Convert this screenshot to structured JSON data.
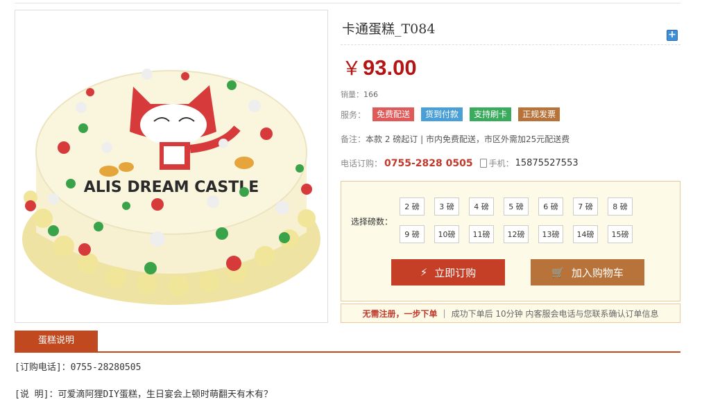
{
  "product": {
    "title": "卡通蛋糕_T084",
    "image_alt": "ALIS DREAM CASTLE",
    "currency": "￥",
    "price": "93.00",
    "sales_label": "销量：",
    "sales_value": "166",
    "service_label": "服务：",
    "service_tags": [
      {
        "label": "免费配送",
        "color": "#e05a5a"
      },
      {
        "label": "货到付款",
        "color": "#4a9fd6"
      },
      {
        "label": "支持刷卡",
        "color": "#3aab5c"
      },
      {
        "label": "正规发票",
        "color": "#b7733a"
      }
    ],
    "note_label": "备注：",
    "note_text": "本款 2 磅起订 | 市内免费配送，市区外需加25元配送费",
    "phone_label": "电话订购：",
    "phone_number": "0755-2828 0505",
    "mobile_label": "手机：",
    "mobile_number": "15875527553"
  },
  "buybox": {
    "select_label": "选择磅数：",
    "pounds": [
      "2 磅",
      "3 磅",
      "4 磅",
      "5 磅",
      "6 磅",
      "7 磅",
      "8 磅",
      "9 磅",
      "10磅",
      "11磅",
      "12磅",
      "13磅",
      "14磅",
      "15磅"
    ],
    "buy_button": "立即订购",
    "cart_button": "加入购物车"
  },
  "register_bar": {
    "highlight": "无需注册，一步下单",
    "separator": "|",
    "text": "成功下单后 10分钟 内客服会电话与您联系确认订单信息"
  },
  "tabs": {
    "description": "蛋糕说明"
  },
  "description": {
    "line1": "[订购电话]：0755-28280505",
    "line2": "[说 明]：可爱滴阿狸DIY蛋糕，生日宴会上顿时萌翻天有木有？"
  }
}
